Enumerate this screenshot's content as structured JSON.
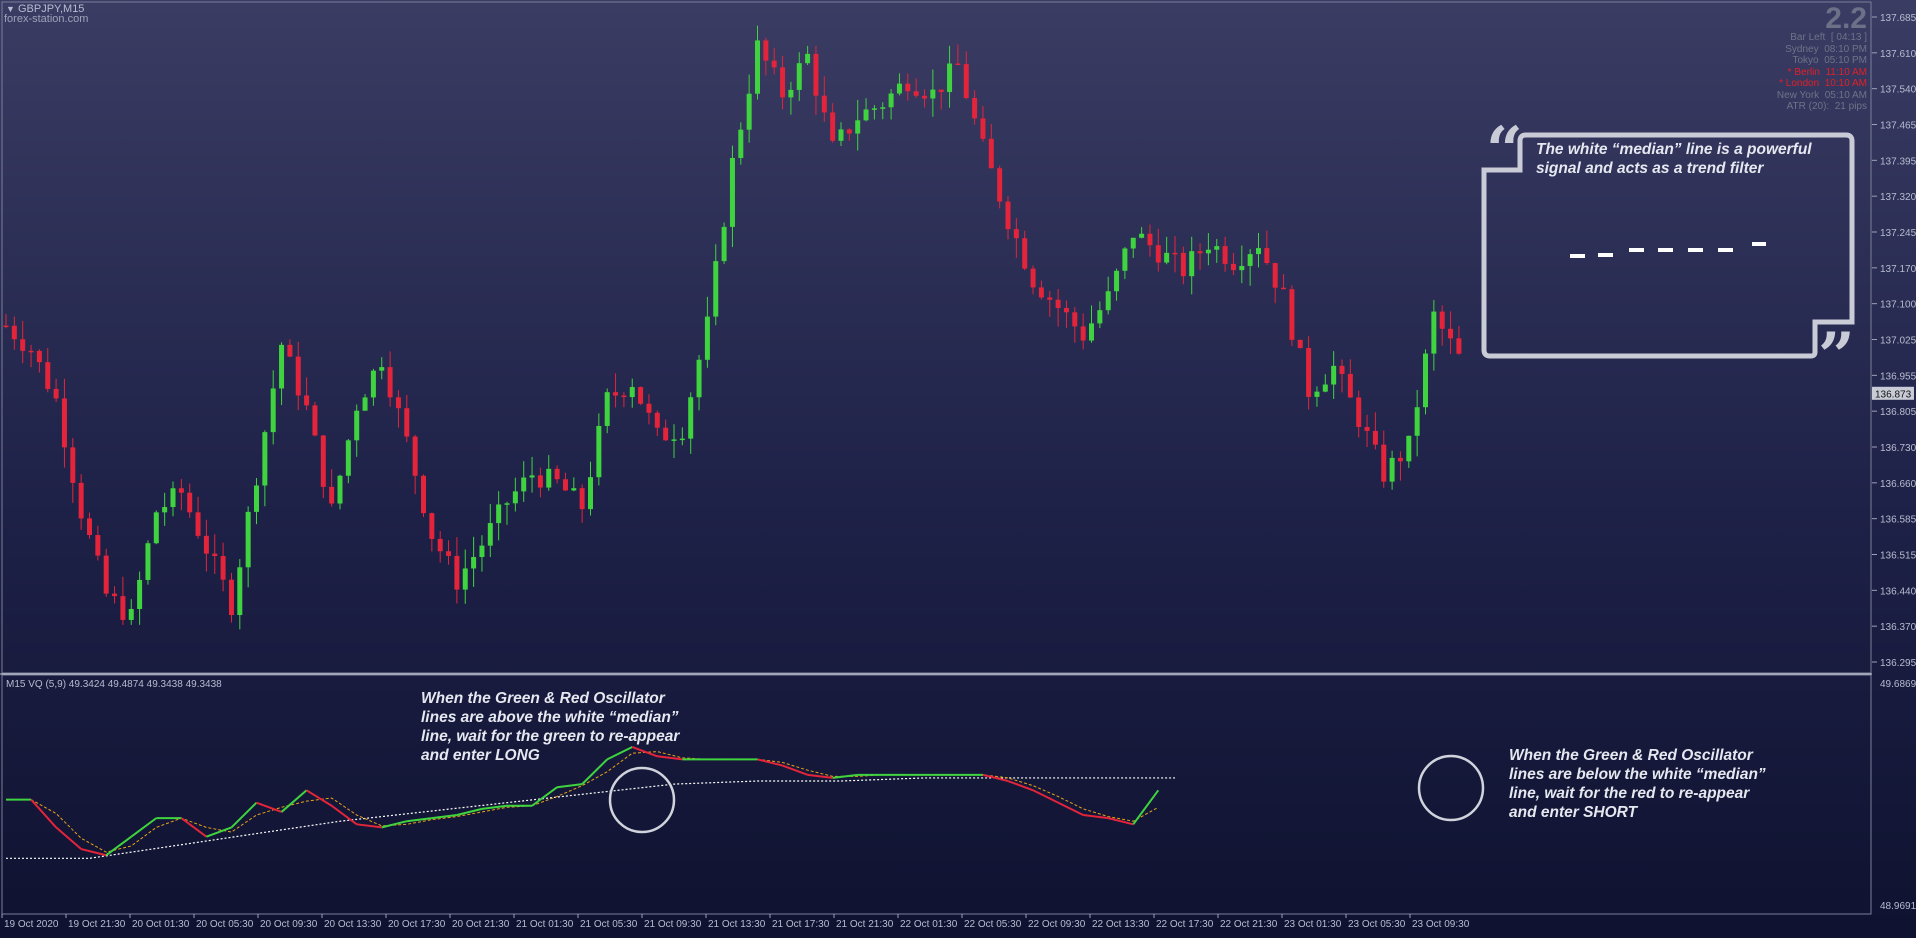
{
  "header": {
    "symbol": "GBPJPY,M15",
    "watermark": "forex-station.com"
  },
  "info_panel": {
    "value": "2.2",
    "rows": [
      {
        "label": "Bar Left",
        "value": "[ 04:13 ]",
        "color": "#6f7387"
      },
      {
        "label": "Sydney",
        "value": "08:10 PM",
        "color": "#6f7387"
      },
      {
        "label": "Tokyo",
        "value": "05:10 PM",
        "color": "#6f7387"
      },
      {
        "label": "* Berlin",
        "value": "11:10 AM",
        "color": "#e0202a"
      },
      {
        "label": "* London",
        "value": "10:10 AM",
        "color": "#e0202a"
      },
      {
        "label": "New York",
        "value": "05:10 AM",
        "color": "#6f7387"
      },
      {
        "label": "ATR (20)",
        "value": "21 pips",
        "color": "#6f7387"
      }
    ]
  },
  "price_axis": {
    "labels": [
      "137.685",
      "137.610",
      "137.540",
      "137.465",
      "137.395",
      "137.320",
      "137.245",
      "137.170",
      "137.100",
      "137.025",
      "136.955",
      "136.873",
      "136.805",
      "136.730",
      "136.660",
      "136.585",
      "136.515",
      "136.440",
      "136.370",
      "136.295"
    ],
    "current_price": "136.873"
  },
  "indicator": {
    "title": "M15 VQ (5,9) 49.3424 49.4874 49.3438 49.3438",
    "axis_top": "49.6869",
    "axis_bottom": "48.9691"
  },
  "time_axis": {
    "labels": [
      "19 Oct 2020",
      "19 Oct 21:30",
      "20 Oct 01:30",
      "20 Oct 05:30",
      "20 Oct 09:30",
      "20 Oct 13:30",
      "20 Oct 17:30",
      "20 Oct 21:30",
      "21 Oct 01:30",
      "21 Oct 05:30",
      "21 Oct 09:30",
      "21 Oct 13:30",
      "21 Oct 17:30",
      "21 Oct 21:30",
      "22 Oct 01:30",
      "22 Oct 05:30",
      "22 Oct 09:30",
      "22 Oct 13:30",
      "22 Oct 17:30",
      "22 Oct 21:30",
      "23 Oct 01:30",
      "23 Oct 05:30",
      "23 Oct 09:30"
    ]
  },
  "annotations": {
    "quote_lines": [
      "The white “median” line is a powerful",
      "signal and acts as a trend filter"
    ],
    "long_lines": [
      "When the Green & Red Oscillator",
      "lines are above the white “median”",
      "line, wait for the green to re-appear",
      "and enter LONG"
    ],
    "short_lines": [
      "When the Green & Red Oscillator",
      "lines are below the white “median”",
      "line, wait for the red to re-appear",
      "and enter SHORT"
    ]
  },
  "colors": {
    "bull": "#3fd43f",
    "bear": "#e3243b",
    "median": "#ffffff",
    "signal": "#e8a21a",
    "panel_border": "#c9ccd6"
  },
  "chart_data": [
    {
      "type": "candlestick",
      "title": "GBPJPY,M15",
      "ylim": [
        136.295,
        137.685
      ],
      "x_labels": [
        "19 Oct 2020",
        "19 Oct 21:30",
        "20 Oct 01:30",
        "20 Oct 05:30",
        "20 Oct 09:30",
        "20 Oct 13:30",
        "20 Oct 17:30",
        "20 Oct 21:30",
        "21 Oct 01:30",
        "21 Oct 05:30",
        "21 Oct 09:30",
        "21 Oct 13:30",
        "21 Oct 17:30",
        "21 Oct 21:30",
        "22 Oct 01:30",
        "22 Oct 05:30",
        "22 Oct 09:30",
        "22 Oct 13:30",
        "22 Oct 17:30",
        "22 Oct 21:30",
        "23 Oct 01:30",
        "23 Oct 05:30",
        "23 Oct 09:30"
      ],
      "close_path": [
        [
          0,
          137.02
        ],
        [
          3,
          136.97
        ],
        [
          6,
          136.86
        ],
        [
          9,
          136.62
        ],
        [
          12,
          136.44
        ],
        [
          15,
          136.39
        ],
        [
          18,
          136.62
        ],
        [
          21,
          136.66
        ],
        [
          24,
          136.54
        ],
        [
          27,
          136.42
        ],
        [
          30,
          136.7
        ],
        [
          33,
          136.98
        ],
        [
          36,
          136.84
        ],
        [
          39,
          136.62
        ],
        [
          42,
          136.85
        ],
        [
          45,
          136.95
        ],
        [
          48,
          136.77
        ],
        [
          51,
          136.57
        ],
        [
          54,
          136.47
        ],
        [
          57,
          136.55
        ],
        [
          60,
          136.64
        ],
        [
          63,
          136.7
        ],
        [
          66,
          136.68
        ],
        [
          69,
          136.63
        ],
        [
          72,
          136.86
        ],
        [
          75,
          136.9
        ],
        [
          78,
          136.78
        ],
        [
          81,
          136.8
        ],
        [
          84,
          137.02
        ],
        [
          87,
          137.37
        ],
        [
          90,
          137.62
        ],
        [
          93,
          137.52
        ],
        [
          96,
          137.6
        ],
        [
          99,
          137.4
        ],
        [
          102,
          137.47
        ],
        [
          105,
          137.5
        ],
        [
          108,
          137.55
        ],
        [
          111,
          137.52
        ],
        [
          114,
          137.58
        ],
        [
          117,
          137.4
        ],
        [
          120,
          137.25
        ],
        [
          123,
          137.12
        ],
        [
          126,
          137.06
        ],
        [
          129,
          137.0
        ],
        [
          132,
          137.08
        ],
        [
          135,
          137.22
        ],
        [
          138,
          137.18
        ],
        [
          141,
          137.14
        ],
        [
          144,
          137.2
        ],
        [
          147,
          137.16
        ],
        [
          150,
          137.2
        ],
        [
          153,
          137.08
        ],
        [
          156,
          136.88
        ],
        [
          159,
          136.93
        ],
        [
          162,
          136.82
        ],
        [
          165,
          136.7
        ],
        [
          168,
          136.76
        ],
        [
          171,
          137.04
        ],
        [
          174,
          136.95
        ]
      ],
      "current_price": 136.873
    },
    {
      "type": "line",
      "title": "M15 VQ (5,9) 49.3424 49.4874 49.3438 49.3438",
      "ylim": [
        48.9691,
        49.6869
      ],
      "series": [
        {
          "values": [
            [
              0,
              49.31
            ],
            [
              3,
              49.31
            ],
            [
              6,
              49.22
            ],
            [
              9,
              49.15
            ],
            [
              12,
              49.13
            ],
            [
              15,
              49.19
            ],
            [
              18,
              49.25
            ],
            [
              21,
              49.25
            ],
            [
              24,
              49.19
            ],
            [
              27,
              49.22
            ],
            [
              30,
              49.3
            ],
            [
              33,
              49.27
            ],
            [
              36,
              49.34
            ],
            [
              39,
              49.29
            ],
            [
              42,
              49.23
            ],
            [
              45,
              49.22
            ],
            [
              48,
              49.24
            ],
            [
              51,
              49.25
            ],
            [
              54,
              49.26
            ],
            [
              57,
              49.28
            ],
            [
              60,
              49.29
            ],
            [
              63,
              49.29
            ],
            [
              66,
              49.35
            ],
            [
              69,
              49.36
            ],
            [
              72,
              49.44
            ],
            [
              75,
              49.48
            ],
            [
              78,
              49.45
            ],
            [
              81,
              49.44
            ],
            [
              84,
              49.44
            ],
            [
              87,
              49.44
            ],
            [
              90,
              49.44
            ],
            [
              93,
              49.42
            ],
            [
              96,
              49.39
            ],
            [
              99,
              49.38
            ],
            [
              102,
              49.39
            ],
            [
              105,
              49.39
            ],
            [
              108,
              49.39
            ],
            [
              111,
              49.39
            ],
            [
              114,
              49.39
            ],
            [
              117,
              49.39
            ],
            [
              120,
              49.37
            ],
            [
              123,
              49.34
            ],
            [
              126,
              49.3
            ],
            [
              129,
              49.26
            ],
            [
              132,
              49.25
            ],
            [
              135,
              49.23
            ],
            [
              138,
              49.34
            ]
          ]
        },
        {
          "values": [
            [
              0,
              49.12
            ],
            [
              10,
              49.12
            ],
            [
              20,
              49.16
            ],
            [
              30,
              49.2
            ],
            [
              40,
              49.24
            ],
            [
              50,
              49.27
            ],
            [
              60,
              49.3
            ],
            [
              70,
              49.33
            ],
            [
              80,
              49.36
            ],
            [
              90,
              49.37
            ],
            [
              100,
              49.37
            ],
            [
              110,
              49.38
            ],
            [
              120,
              49.38
            ],
            [
              130,
              49.38
            ],
            [
              140,
              49.38
            ]
          ]
        }
      ]
    }
  ]
}
